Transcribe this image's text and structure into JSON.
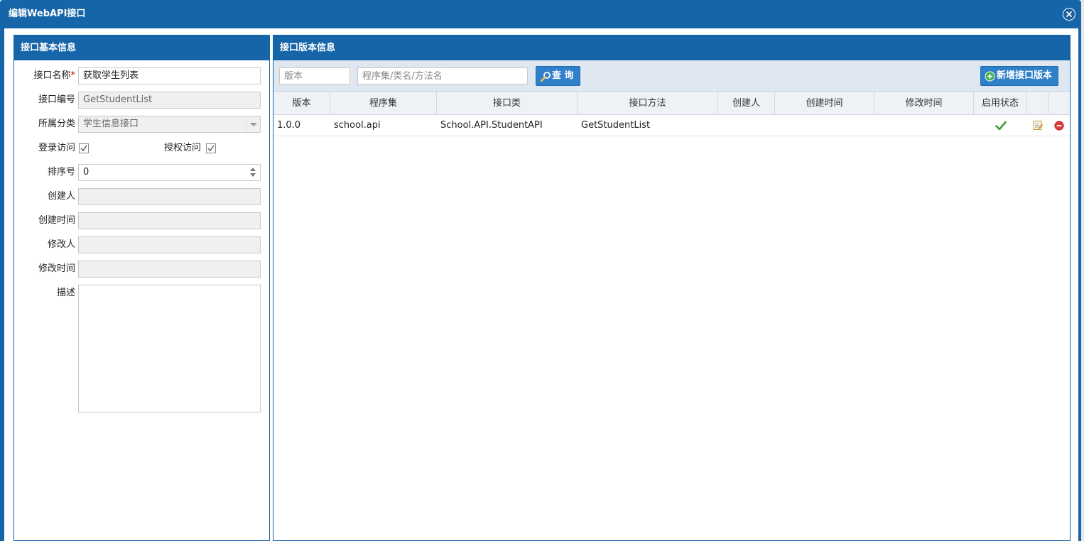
{
  "window": {
    "title": "编辑WebAPI接口"
  },
  "left_panel": {
    "title": "接口基本信息",
    "fields": {
      "name": {
        "label": "接口名称",
        "required_mark": "*",
        "value": "获取学生列表"
      },
      "code": {
        "label": "接口编号",
        "value": "GetStudentList"
      },
      "category": {
        "label": "所属分类",
        "value": "学生信息接口"
      },
      "login_access": {
        "label": "登录访问",
        "checked": true
      },
      "auth_access": {
        "label": "授权访问",
        "checked": true
      },
      "sort": {
        "label": "排序号",
        "value": "0"
      },
      "creator": {
        "label": "创建人",
        "value": ""
      },
      "created_time": {
        "label": "创建时间",
        "value": ""
      },
      "modifier": {
        "label": "修改人",
        "value": ""
      },
      "modified_time": {
        "label": "修改时间",
        "value": ""
      },
      "description": {
        "label": "描述",
        "value": ""
      }
    }
  },
  "right_panel": {
    "title": "接口版本信息",
    "toolbar": {
      "version_placeholder": "版本",
      "search_placeholder": "程序集/类名/方法名",
      "query_label": "查 询",
      "add_label": "新增接口版本"
    },
    "table": {
      "columns": [
        "版本",
        "程序集",
        "接口类",
        "接口方法",
        "创建人",
        "创建时间",
        "修改时间",
        "启用状态",
        "",
        ""
      ],
      "rows": [
        {
          "version": "1.0.0",
          "assembly": "school.api",
          "class": "School.API.StudentAPI",
          "method": "GetStudentList",
          "creator": "",
          "created_time": "",
          "modified_time": "",
          "enabled": true
        }
      ]
    }
  },
  "colors": {
    "primary": "#1565a8",
    "button": "#2f7fc9",
    "toolbar_bg": "#dfe8f1"
  },
  "icons": [
    "close-icon",
    "search-icon",
    "add-circle-icon",
    "checkmark-icon",
    "edit-icon",
    "delete-icon"
  ]
}
